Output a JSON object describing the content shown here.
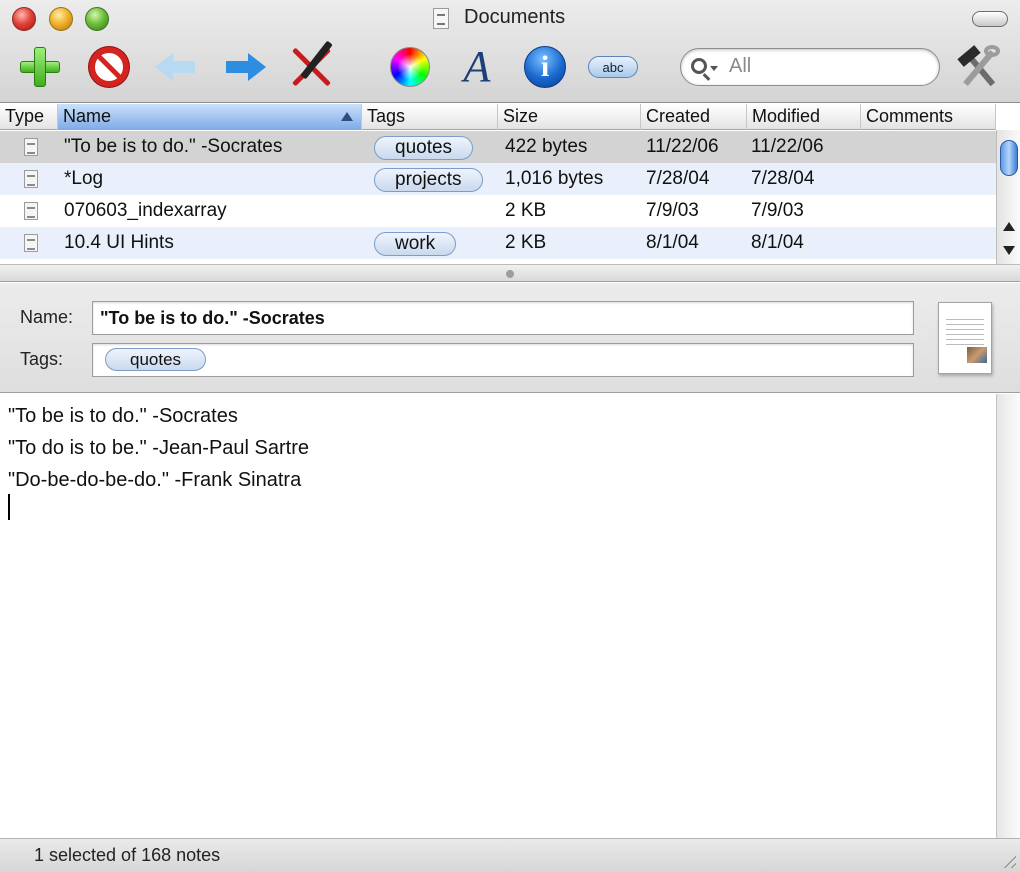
{
  "window": {
    "title": "Documents"
  },
  "toolbar": {
    "buttons": [
      {
        "name": "add-note-button",
        "icon": "plus-icon"
      },
      {
        "name": "delete-note-button",
        "icon": "no-entry-icon"
      },
      {
        "name": "back-button",
        "icon": "left-arrow-icon"
      },
      {
        "name": "forward-button",
        "icon": "right-arrow-icon"
      },
      {
        "name": "edit-button",
        "icon": "crossed-pen-icon"
      },
      {
        "name": "colors-button",
        "icon": "color-wheel-icon"
      },
      {
        "name": "fonts-button",
        "icon": "font-icon"
      },
      {
        "name": "info-button",
        "icon": "info-icon"
      },
      {
        "name": "spelling-button",
        "icon": "abc-icon"
      },
      {
        "name": "preferences-button",
        "icon": "tools-icon"
      }
    ],
    "font_glyph": "A",
    "info_glyph": "i",
    "spelling_label": "abc",
    "search": {
      "placeholder": "All"
    }
  },
  "table": {
    "columns": [
      "Type",
      "Name",
      "Tags",
      "Size",
      "Created",
      "Modified",
      "Comments"
    ],
    "sorted_column": "Name",
    "rows": [
      {
        "name": "\"To be is to do.\" -Socrates",
        "tag": "quotes",
        "size": "422 bytes",
        "created": "11/22/06",
        "modified": "11/22/06",
        "selected": true
      },
      {
        "name": "*Log",
        "tag": "projects",
        "size": "1,016 bytes",
        "created": "7/28/04",
        "modified": "7/28/04",
        "selected": false
      },
      {
        "name": "070603_indexarray",
        "tag": "",
        "size": "2 KB",
        "created": "7/9/03",
        "modified": "7/9/03",
        "selected": false
      },
      {
        "name": "10.4 UI Hints",
        "tag": "work",
        "size": "2 KB",
        "created": "8/1/04",
        "modified": "8/1/04",
        "selected": false
      }
    ]
  },
  "note": {
    "name_label": "Name:",
    "name_value": "\"To be is to do.\" -Socrates",
    "tags_label": "Tags:",
    "tags": [
      "quotes"
    ],
    "body_lines": [
      "\"To be is to do.\" -Socrates",
      "\"To do is to be.\" -Jean-Paul Sartre",
      "\"Do-be-do-be-do.\" -Frank Sinatra"
    ]
  },
  "status": {
    "text": "1 selected of 168 notes"
  },
  "colors": {
    "selected_row": "#d3d3d3",
    "alt_row": "#e9f0fb",
    "sorted_header": "#9fc2ee",
    "tag_pill_border": "#7d9cc7"
  }
}
